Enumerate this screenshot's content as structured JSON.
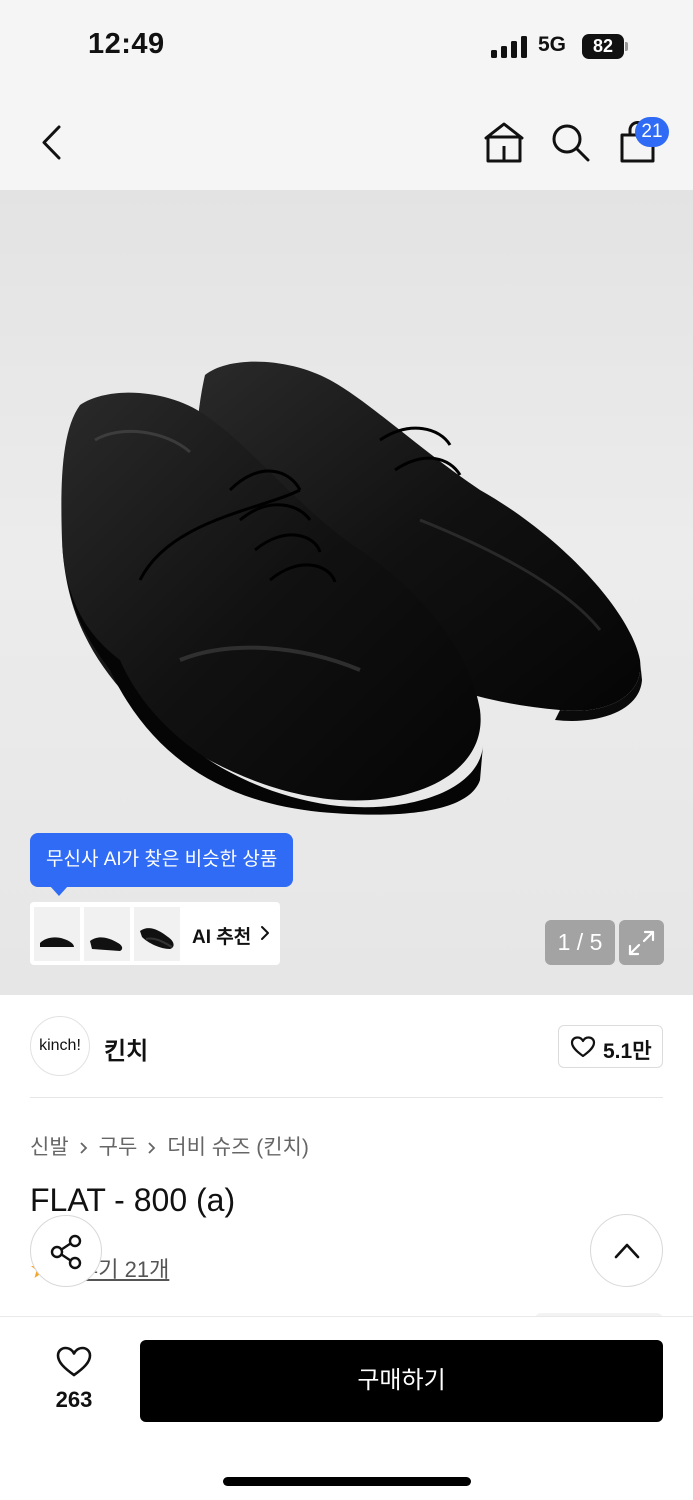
{
  "status_bar": {
    "time": "12:49",
    "network": "5G",
    "battery": "82"
  },
  "header": {
    "back_icon": "chevron-left-icon",
    "home_icon": "home-icon",
    "search_icon": "search-icon",
    "cart_icon": "shopping-bag-icon",
    "cart_badge": "21"
  },
  "hero": {
    "ai_tooltip": "무신사 AI가 찾은 비슷한 상품",
    "ai_recommend_label": "AI 추천",
    "image_counter": "1 / 5",
    "expand_icon": "expand-icon"
  },
  "brand": {
    "logo_text": "kinch!",
    "name": "킨치",
    "like_count": "5.1만"
  },
  "product": {
    "breadcrumb": [
      "신발",
      "구두",
      "더비 슈즈 (킨치)"
    ],
    "title": "FLAT - 800 (a)",
    "review_text": "후기 21개"
  },
  "bottom_bar": {
    "wish_count": "263",
    "buy_label": "구매하기"
  },
  "colors": {
    "accent": "#2f6bf4",
    "buy_button": "#000000"
  }
}
